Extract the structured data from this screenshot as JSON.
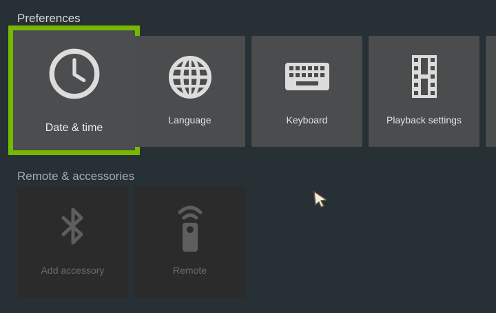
{
  "sections": {
    "preferences": {
      "title": "Preferences",
      "tiles": [
        {
          "label": "Date & time",
          "icon": "clock-icon",
          "focused": true
        },
        {
          "label": "Language",
          "icon": "globe-icon"
        },
        {
          "label": "Keyboard",
          "icon": "keyboard-icon"
        },
        {
          "label": "Playback settings",
          "icon": "film-strip-icon"
        }
      ]
    },
    "remote": {
      "title": "Remote & accessories",
      "tiles": [
        {
          "label": "Add accessory",
          "icon": "bluetooth-icon",
          "enabled": false
        },
        {
          "label": "Remote",
          "icon": "remote-control-icon",
          "enabled": false
        }
      ]
    }
  },
  "colors": {
    "background": "#263035",
    "tile": "#4a4c4d",
    "focus_border": "#76b900",
    "disabled_tile": "#2b2b2b"
  }
}
